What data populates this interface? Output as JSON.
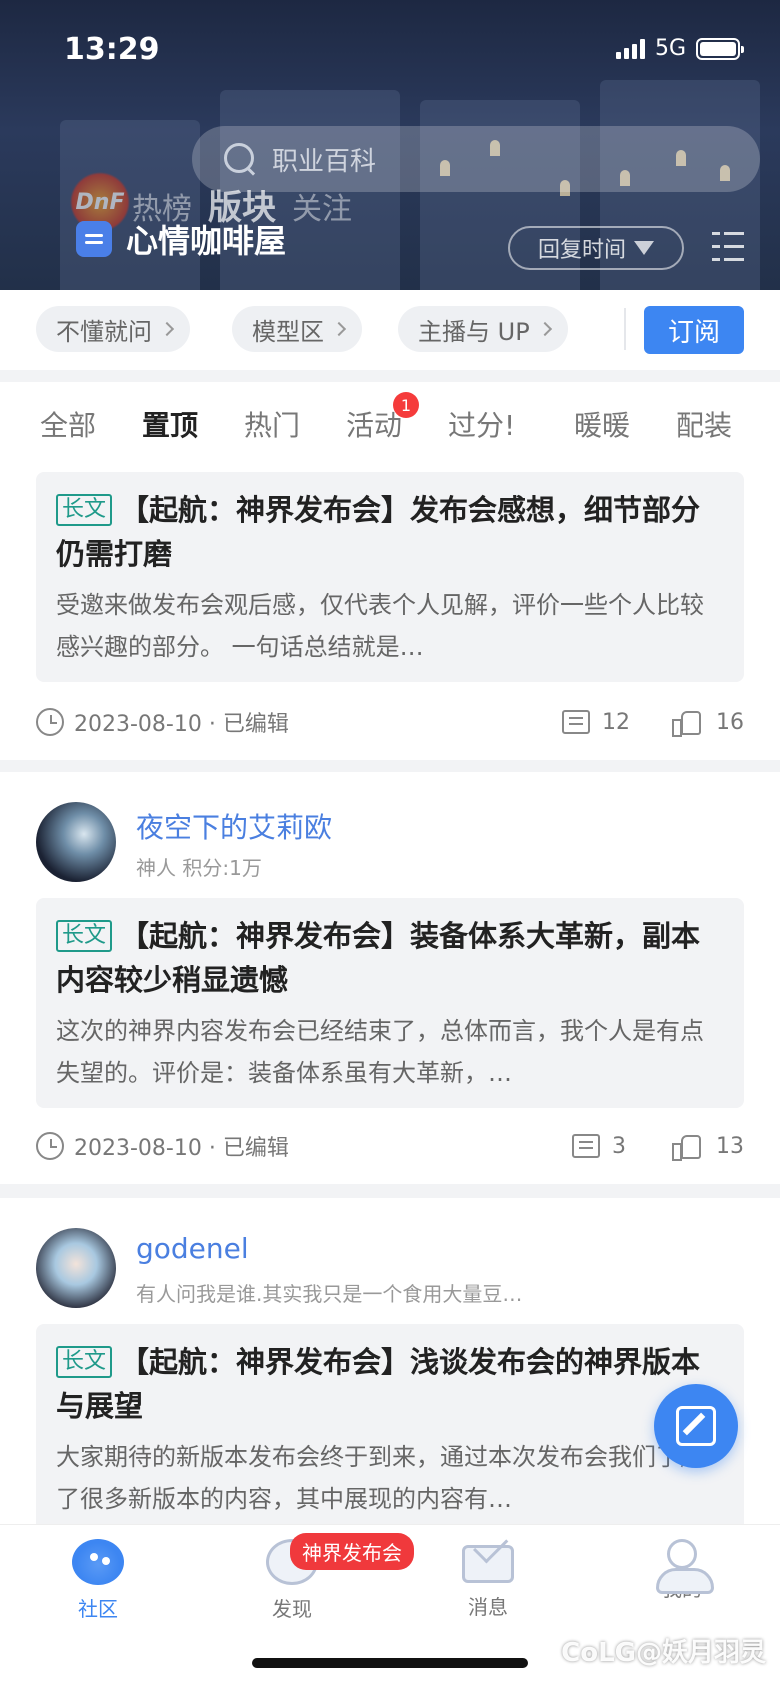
{
  "status": {
    "time": "13:29",
    "network": "5G"
  },
  "header": {
    "search_placeholder": "职业百科",
    "logo_text": "DnF",
    "tabs": [
      "热榜",
      "版块",
      "关注"
    ],
    "forum_name": "心情咖啡屋",
    "sort_label": "回复时间"
  },
  "subforums": {
    "chips": [
      "不懂就问",
      "模型区",
      "主播与 UP"
    ],
    "subscribe_label": "订阅"
  },
  "categories": {
    "items": [
      "全部",
      "置顶",
      "热门",
      "活动",
      "过分!",
      "暖暖",
      "配装"
    ],
    "active": "置顶",
    "activity_badge": "1"
  },
  "posts": [
    {
      "tag": "长文",
      "title": "【起航：神界发布会】发布会感想，细节部分仍需打磨",
      "excerpt": "        受邀来做发布会观后感，仅代表个人见解，评价一些个人比较感兴趣的部分。        一句话总结就是…",
      "date": "2023-08-10 · 已编辑",
      "comments": "12",
      "likes": "16"
    },
    {
      "author": "夜空下的艾莉欧",
      "author_sub": "神人  积分:1万",
      "tag": "长文",
      "title": "【起航：神界发布会】装备体系大革新，副本内容较少稍显遗憾",
      "excerpt": " 这次的神界内容发布会已经结束了，总体而言，我个人是有点失望的。评价是：装备体系虽有大革新，…",
      "date": "2023-08-10 · 已编辑",
      "comments": "3",
      "likes": "13"
    },
    {
      "author": "godenel",
      "author_sub": "有人问我是谁.其实我只是一个食用大量豆…",
      "tag": "长文",
      "title": "【起航：神界发布会】浅谈发布会的神界版本与展望",
      "excerpt": "大家期待的新版本发布会终于到来，通过本次发布会我们了解了很多新版本的内容，其中展现的内容有…"
    }
  ],
  "bottom_nav": {
    "items": [
      "社区",
      "发现",
      "消息",
      "我的"
    ],
    "badge": "神界发布会"
  },
  "watermark": "CoLG@妖月羽灵",
  "colors": {
    "accent": "#3d86f2",
    "tag": "#1f9a8a",
    "badge": "#f53b3b"
  }
}
